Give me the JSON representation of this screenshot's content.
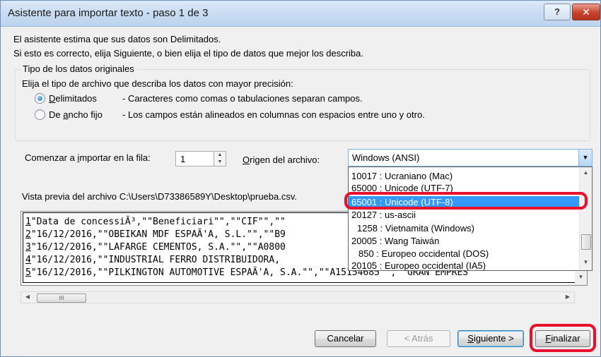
{
  "window": {
    "title": "Asistente para importar texto - paso 1 de 3",
    "help_label": "?",
    "close_label": "✕"
  },
  "intro": {
    "line1": "El asistente estima que sus datos son Delimitados.",
    "line2": "Si esto es correcto, elija Siguiente, o bien elija el tipo de datos que mejor los describa."
  },
  "data_type_group": {
    "legend": "Tipo de los datos originales",
    "instruction": "Elija el tipo de archivo que describa los datos con mayor precisión:",
    "options": [
      {
        "label_prefix": "",
        "mnemonic": "D",
        "label_rest": "elimitados",
        "description": "- Caracteres como comas o tabulaciones separan campos.",
        "selected": true
      },
      {
        "label_prefix": "De ",
        "mnemonic": "a",
        "label_rest": "ncho fijo",
        "description": "- Los campos están alineados en columnas con espacios entre uno y otro.",
        "selected": false
      }
    ]
  },
  "start_row": {
    "label_prefix": "Comenzar a ",
    "mnemonic": "i",
    "label_rest": "mportar en la fila:",
    "value": "1"
  },
  "file_origin": {
    "mnemonic": "O",
    "label_rest": "rigen del archivo:",
    "selected": "Windows (ANSI)",
    "options": [
      "10017 : Ucraniano (Mac)",
      "65000 : Unicode (UTF-7)",
      "65001 : Unicode (UTF-8)",
      "20127 : us-ascii",
      "1258 : Vietnamita (Windows)",
      "20005 : Wang Taiwán",
      "850 : Europeo occidental (DOS)",
      "20105 : Europeo occidental (IA5)"
    ],
    "highlighted_index": 2
  },
  "preview": {
    "label": "Vista previa del archivo C:\\Users\\D73386589Y\\Desktop\\prueba.csv.",
    "rows": [
      {
        "num": "1",
        "text": "\"Data de concessiÃ³,\"\"Beneficiari\"\",\"\"CIF\"\",\"\""
      },
      {
        "num": "2",
        "text": "\"16/12/2016,\"\"OBEIKAN MDF ESPAÃ'A, S.L.\"\",\"\"B9"
      },
      {
        "num": "3",
        "text": "\"16/12/2016,\"\"LAFARGE CEMENTOS, S.A.\"\",\"\"A0800"
      },
      {
        "num": "4",
        "text": "\"16/12/2016,\"\"INDUSTRIAL FERRO DISTRIBUIDORA,"
      },
      {
        "num": "5",
        "text": "\"16/12/2016,\"\"PILKINGTON AUTOMOTIVE ESPAÃ'A, S.A.\"\",\"\"A15154685\"\",\"\"GRAN EMPRES"
      }
    ]
  },
  "buttons": {
    "cancel": "Cancelar",
    "back": "< Atrás",
    "next_mnemonic": "S",
    "next_rest": "iguiente >",
    "finish_mnemonic": "F",
    "finish_rest": "inalizar"
  },
  "icons": {
    "help": "help-icon",
    "close": "close-icon",
    "dropdown_arrow": "chevron-down-icon",
    "spin_up": "triangle-up-icon",
    "spin_down": "triangle-down-icon",
    "scroll_left": "arrow-left-icon",
    "scroll_right": "arrow-right-icon",
    "scroll_up": "arrow-up-icon",
    "scroll_down": "arrow-down-icon",
    "thumb_grip": "grip-icon"
  },
  "colors": {
    "highlight_annotation": "#e8112d",
    "selection": "#3399ff",
    "dialog_bg": "#f0f0f0"
  }
}
